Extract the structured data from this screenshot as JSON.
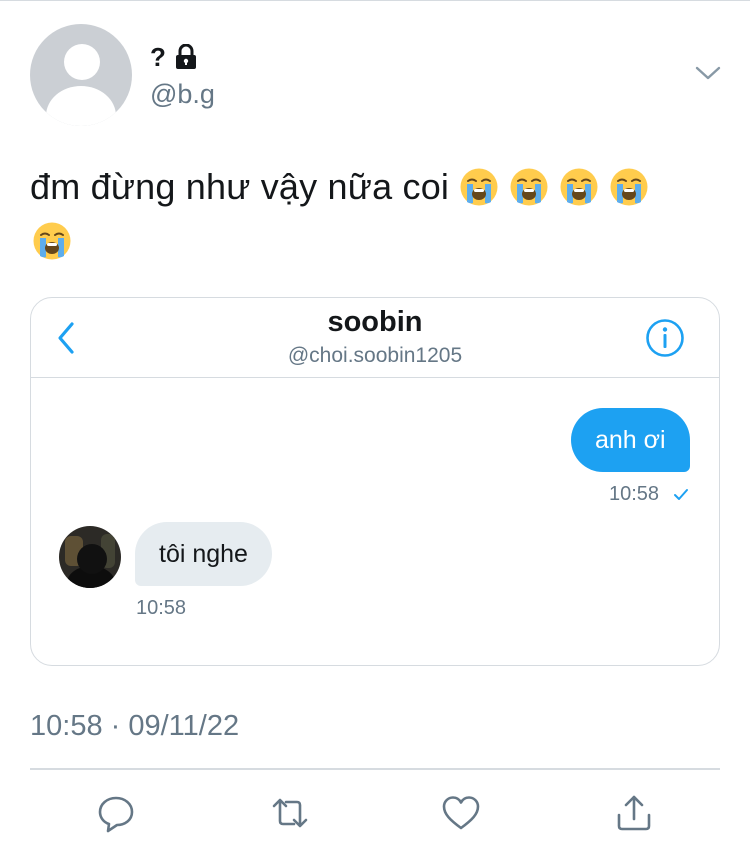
{
  "user": {
    "display_name": "?",
    "handle": "@b.g"
  },
  "tweet": {
    "text": "đm đừng như vậy nữa coi",
    "emoji_name": "loudly-crying-face",
    "emoji_count": 5,
    "timestamp": "10:58 · 09/11/22"
  },
  "dm_card": {
    "name": "soobin",
    "handle": "@choi.soobin1205",
    "messages": [
      {
        "direction": "outgoing",
        "text": "anh ơi",
        "time": "10:58"
      },
      {
        "direction": "incoming",
        "text": "tôi nghe",
        "time": "10:58"
      }
    ]
  },
  "actions": [
    "reply",
    "retweet",
    "like",
    "share"
  ],
  "colors": {
    "accent": "#1da1f2",
    "secondary_text": "#657786",
    "border": "#d6dbe0",
    "incoming_bubble": "#e6ecf0"
  }
}
